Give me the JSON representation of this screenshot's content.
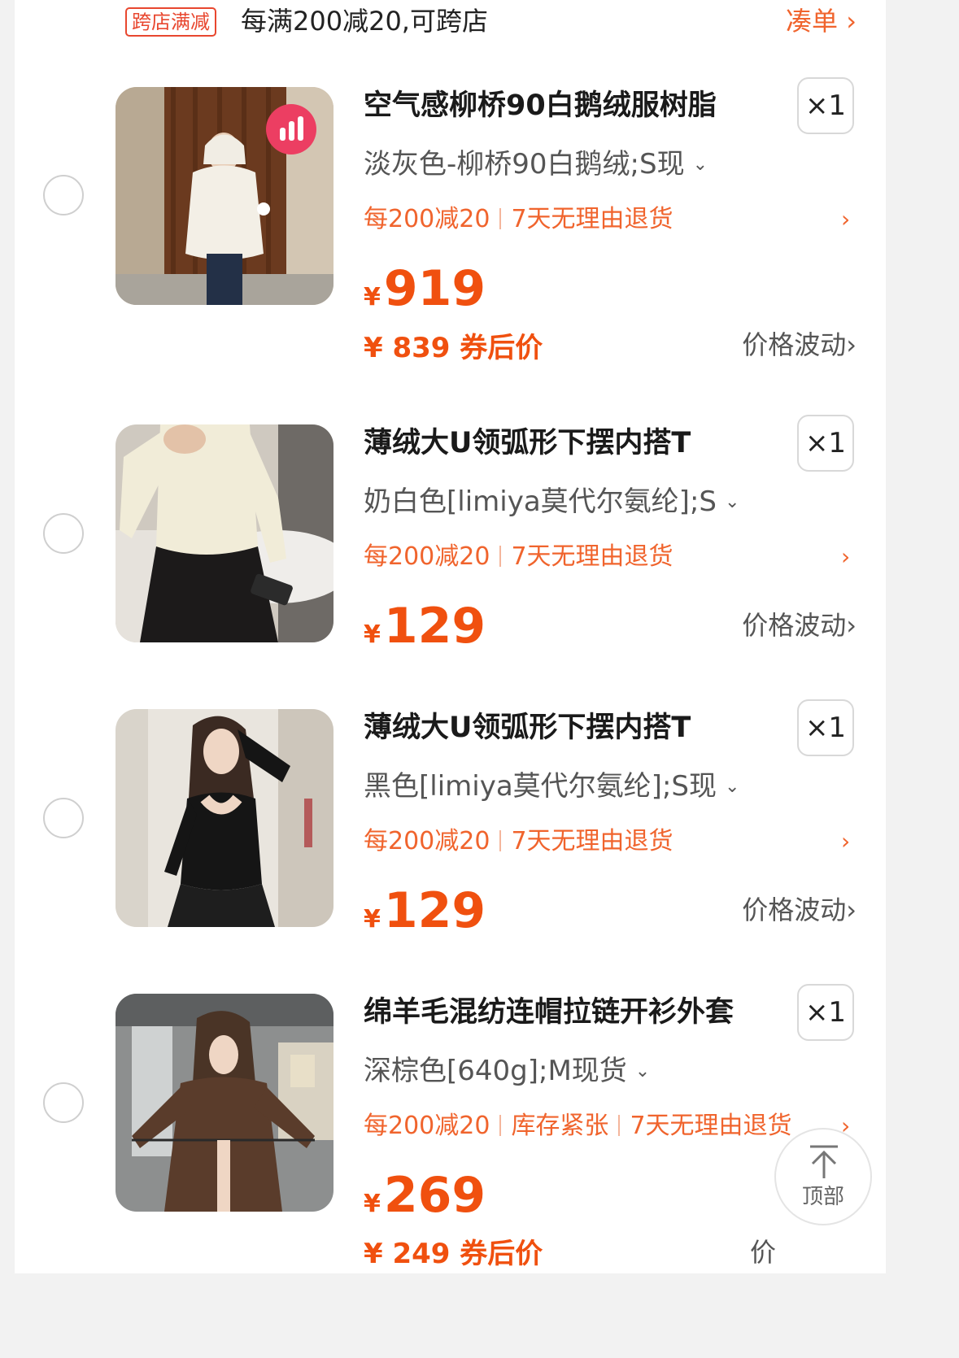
{
  "promo": {
    "tag": "跨店满减",
    "text": "每满200减20,可跨店",
    "link": "凑单 ›"
  },
  "colors": {
    "accent": "#f0642d",
    "price": "#f0500f",
    "tag_border": "#e8472f"
  },
  "items": [
    {
      "title": "空气感柳桥90白鹅绒服树脂",
      "quantity": "×1",
      "sku": "淡灰色-柳桥90白鹅绒;S现",
      "tags": [
        "每200减20",
        "7天无理由退货"
      ],
      "currency": "¥",
      "price": "919",
      "coupon_price": "¥ 839 券后价",
      "price_fluctuation": "价格波动›",
      "badge_icon": "bar-chart-icon"
    },
    {
      "title": "薄绒大U领弧形下摆内搭T",
      "quantity": "×1",
      "sku": "奶白色[limiya莫代尔氨纶];S",
      "tags": [
        "每200减20",
        "7天无理由退货"
      ],
      "currency": "¥",
      "price": "129",
      "price_fluctuation": "价格波动›"
    },
    {
      "title": "薄绒大U领弧形下摆内搭T",
      "quantity": "×1",
      "sku": "黑色[limiya莫代尔氨纶];S现",
      "tags": [
        "每200减20",
        "7天无理由退货"
      ],
      "currency": "¥",
      "price": "129",
      "price_fluctuation": "价格波动›"
    },
    {
      "title": "绵羊毛混纺连帽拉链开衫外套",
      "quantity": "×1",
      "sku": "深棕色[640g];M现货",
      "tags": [
        "每200减20",
        "库存紧张",
        "7天无理由退货"
      ],
      "currency": "¥",
      "price": "269",
      "coupon_price": "¥ 249 券后价",
      "price_fluctuation": "价"
    }
  ],
  "back_to_top": {
    "label": "顶部",
    "icon": "arrow-up-icon"
  }
}
